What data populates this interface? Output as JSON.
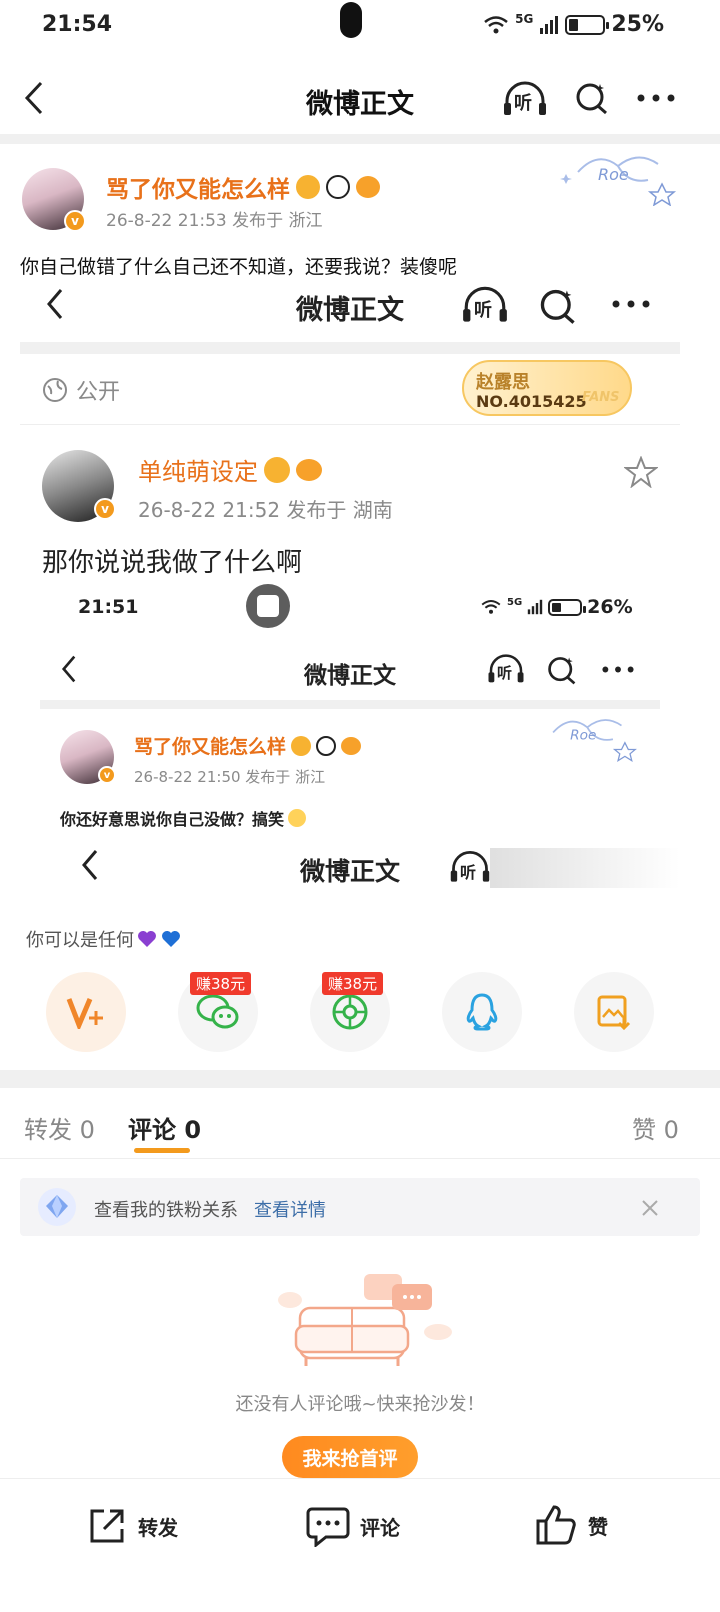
{
  "status_bar": {
    "time": "21:54",
    "network": "5G",
    "battery": "25%"
  },
  "nav": {
    "title": "微博正文",
    "listen_label": "听"
  },
  "post": {
    "author": "骂了你又能怎么样",
    "meta": "26-8-22 21:53  发布于 浙江",
    "text": "你自己做错了什么自己还不知道，还要我说？装傻呢"
  },
  "screenshot1": {
    "nav_title": "微博正文",
    "listen_label": "听",
    "visibility": "公开",
    "fans_badge": {
      "name": "赵露思",
      "number": "NO.4015425",
      "tag": "FANS"
    },
    "author": "单纯萌设定",
    "meta": "26-8-22 21:52  发布于 湖南",
    "text": "那你说说我做了什么啊"
  },
  "screenshot2": {
    "time": "21:51",
    "network": "5G",
    "battery": "26%",
    "nav_title": "微博正文",
    "listen_label": "听",
    "author": "骂了你又能怎么样",
    "meta": "26-8-22 21:50  发布于 浙江",
    "text": "你还好意思说你自己没做？搞笑",
    "nested_nav_title": "微博正文",
    "nested_listen_label": "听"
  },
  "tooltip": {
    "text": "你可以是任何"
  },
  "share": {
    "earn_label_1": "赚38元",
    "earn_label_2": "赚38元"
  },
  "tabs": {
    "repost": "转发 0",
    "comment": "评论 0",
    "like": "赞 0"
  },
  "fans_bar": {
    "text": "查看我的铁粉关系",
    "link": "查看详情"
  },
  "empty": {
    "text": "还没有人评论哦~快来抢沙发！",
    "button": "我来抢首评"
  },
  "bottom": {
    "repost": "转发",
    "comment": "评论",
    "like": "赞"
  },
  "colors": {
    "accent": "#f39a1d",
    "name": "#e8711a",
    "link": "#3d6ea8",
    "earn": "#f03a2c"
  }
}
